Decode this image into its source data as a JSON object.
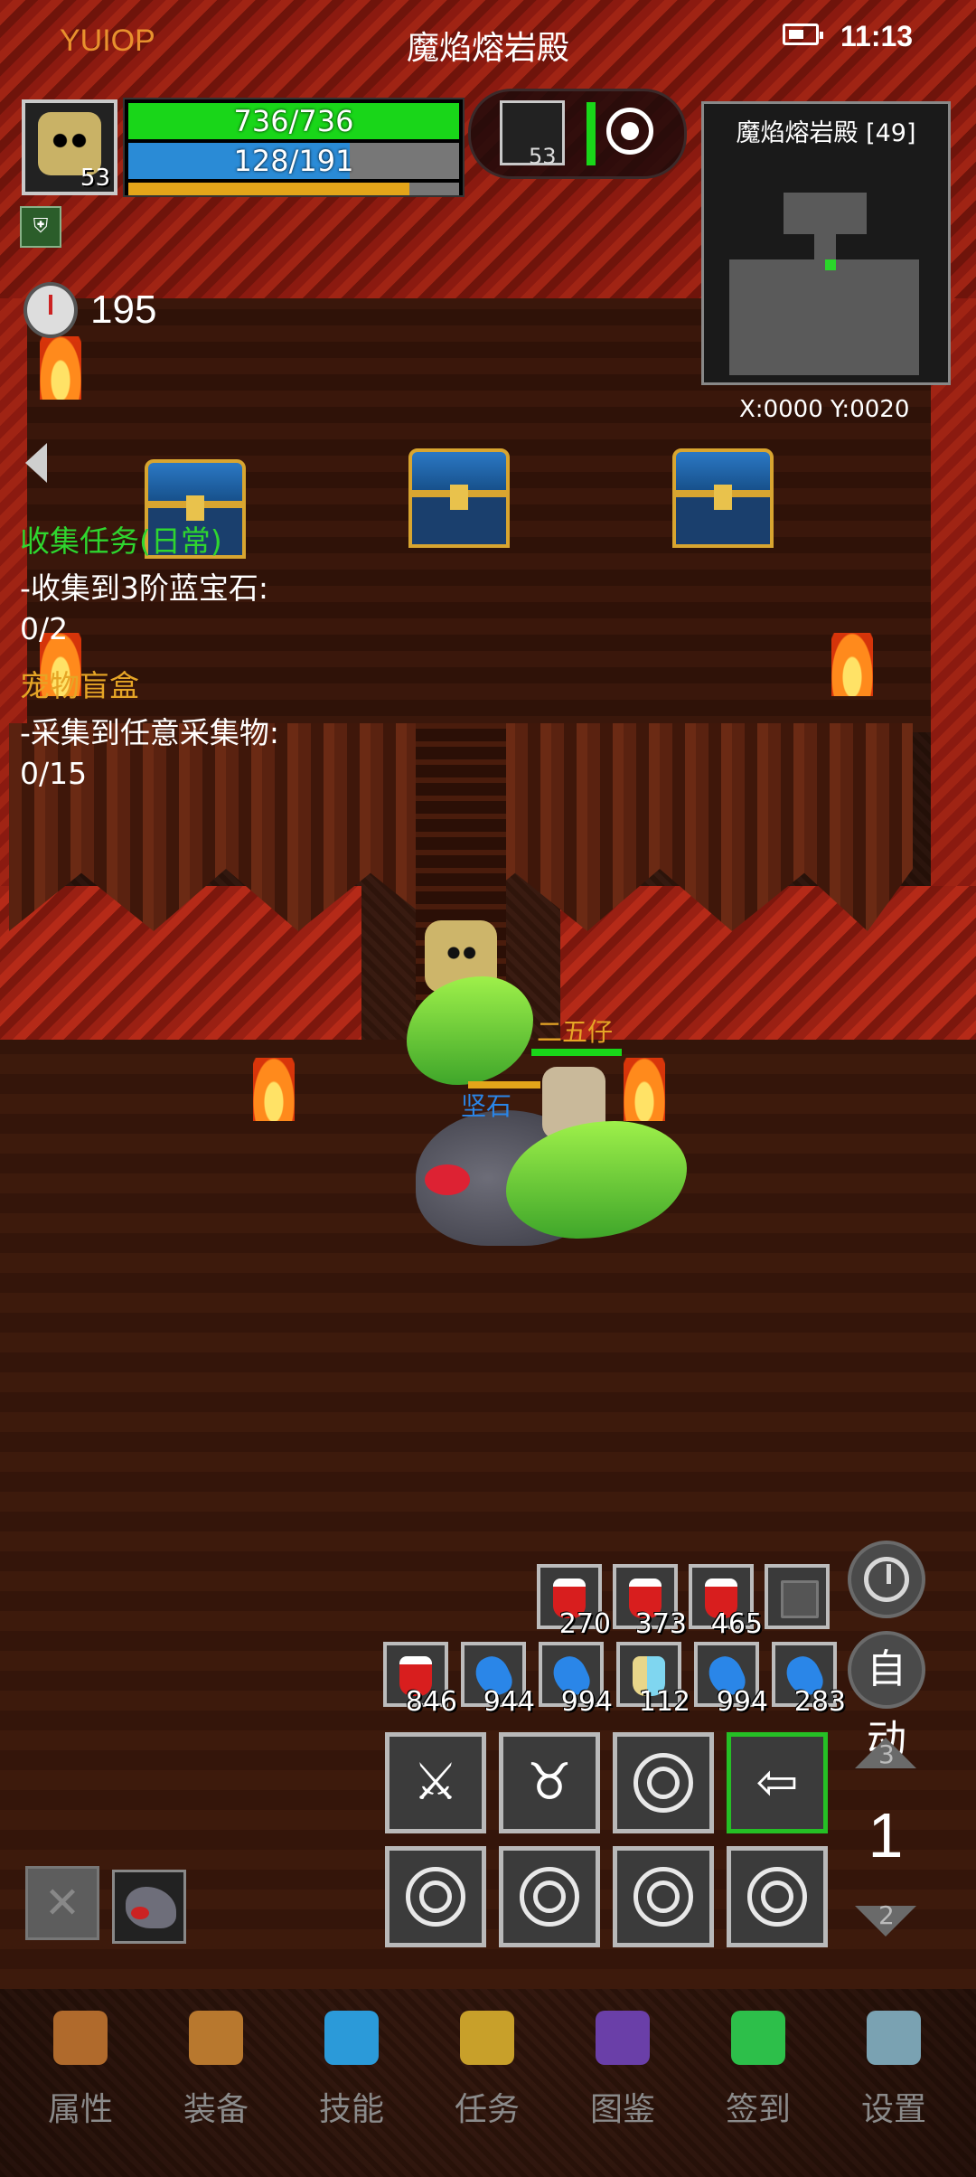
{
  "status": {
    "app": "YUIOP",
    "map_name": "魔焰熔岩殿",
    "time": "11:13"
  },
  "player": {
    "level": "53",
    "hp": "736/736",
    "mp": "128/191",
    "hp_pct": 100,
    "mp_pct": 67,
    "xp_pct": 85
  },
  "pet": {
    "level": "53"
  },
  "minimap": {
    "title": "魔焰熔岩殿 [49]",
    "coords": "X:0000 Y:0020"
  },
  "timer": {
    "value": "195"
  },
  "quests": [
    {
      "title": "收集任务(日常)",
      "line1": "-收集到3阶蓝宝石:",
      "line2": "0/2"
    },
    {
      "title": "宠物盲盒",
      "line1": "-采集到任意采集物:",
      "line2": "0/15"
    }
  ],
  "entities": {
    "ally_name": "二五仔",
    "pet_name": "坚石"
  },
  "hotbar": {
    "row1": [
      {
        "icon": "red-potion-icon",
        "count": "270"
      },
      {
        "icon": "red-potion-icon",
        "count": "373"
      },
      {
        "icon": "red-potion-icon",
        "count": "465"
      },
      {
        "icon": "empty-slot-icon",
        "count": ""
      }
    ],
    "row2": [
      {
        "icon": "red-potion-icon",
        "count": "846"
      },
      {
        "icon": "blue-fish-icon",
        "count": "944"
      },
      {
        "icon": "blue-fish-icon",
        "count": "994"
      },
      {
        "icon": "scroll-icon",
        "count": "112"
      },
      {
        "icon": "blue-fish-icon",
        "count": "994"
      },
      {
        "icon": "blue-fish-icon",
        "count": "283"
      }
    ]
  },
  "controls": {
    "auto_label": "自动",
    "page_up": "3",
    "page_current": "1",
    "page_down": "2"
  },
  "nav": [
    {
      "label": "属性",
      "icon": "helmet-icon",
      "color": "#b06a2c"
    },
    {
      "label": "装备",
      "icon": "bag-icon",
      "color": "#b8782e"
    },
    {
      "label": "技能",
      "icon": "gem-icon",
      "color": "#2b9ad9"
    },
    {
      "label": "任务",
      "icon": "question-icon",
      "color": "#c8a02a"
    },
    {
      "label": "图鉴",
      "icon": "book-icon",
      "color": "#6a3fa8"
    },
    {
      "label": "签到",
      "icon": "emerald-icon",
      "color": "#2dbf4a"
    },
    {
      "label": "设置",
      "icon": "gear-icon",
      "color": "#7aa2b2"
    }
  ]
}
